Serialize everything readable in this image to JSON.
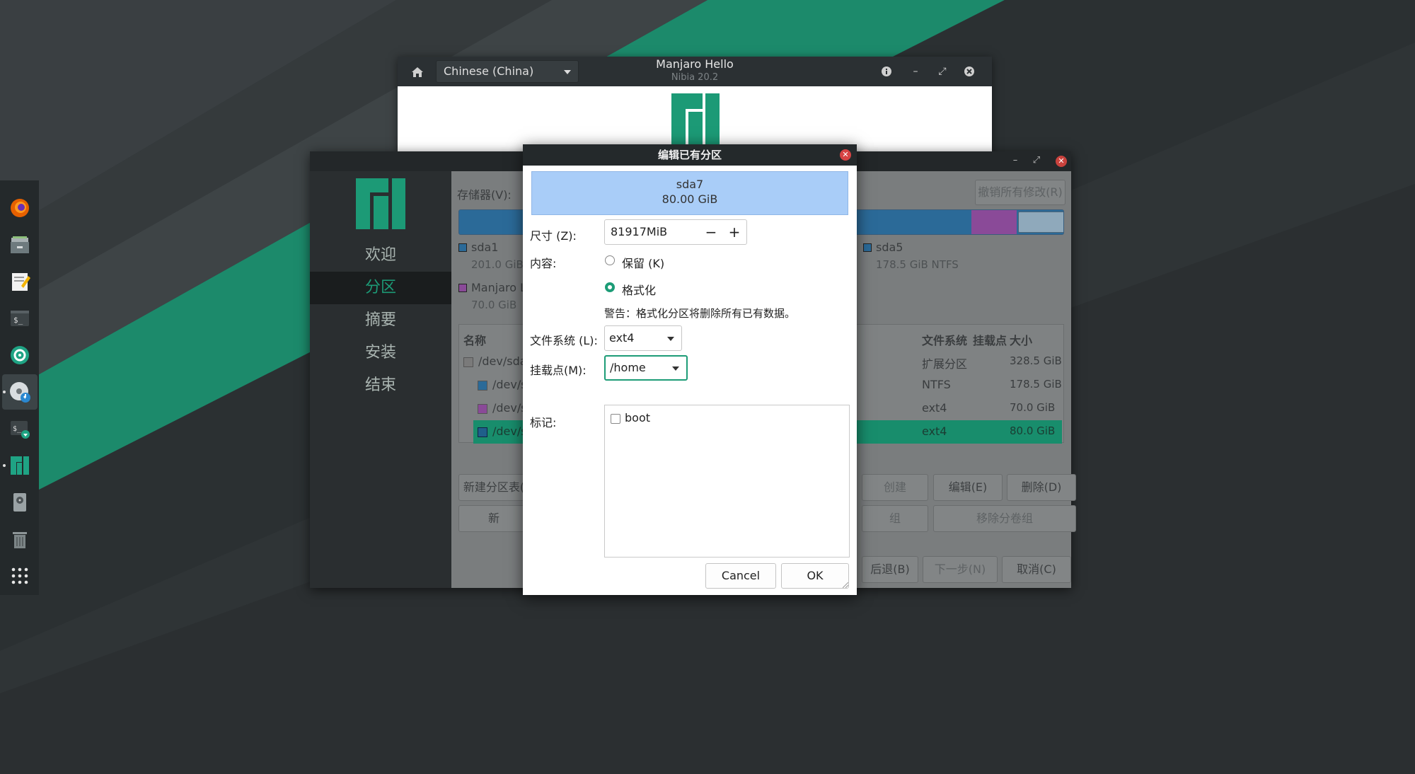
{
  "hello_window": {
    "language": "Chinese (China)",
    "title": "Manjaro Hello",
    "subtitle": "Nibia 20.2"
  },
  "installer": {
    "nav": [
      "欢迎",
      "分区",
      "摘要",
      "安装",
      "结束"
    ],
    "active_nav_index": 1,
    "storage_label": "存储器(V):",
    "revert_button": "撤销所有修改(R)",
    "legend": [
      {
        "name": "sda1",
        "detail": "201.0 GiB",
        "color": "#2b6a98"
      },
      {
        "name": "Manjaro L",
        "detail": "70.0 GiB",
        "color": "#8a4a98"
      },
      {
        "name": "sda5",
        "detail": "178.5 GiB  NTFS",
        "color": "#2b6a98"
      }
    ],
    "table_headers": {
      "name": "名称",
      "fs": "文件系统",
      "mount": "挂载点",
      "size": "大小"
    },
    "rows": [
      {
        "name": "/dev/sda",
        "fs": "扩展分区",
        "size": "328.5 GiB",
        "color": "#7a7a7a"
      },
      {
        "name": "/dev/s",
        "fs": "NTFS",
        "size": "178.5 GiB",
        "color": "#2b6a98"
      },
      {
        "name": "/dev/s",
        "fs": "ext4",
        "size": "70.0 GiB",
        "color": "#8a4a98"
      },
      {
        "name": "/dev/s",
        "fs": "ext4",
        "size": "80.0 GiB",
        "color": "#1f5f8a"
      }
    ],
    "selected_row_index": 3,
    "buttons": {
      "new_table": "新建分区表(",
      "create": "创建",
      "edit": "编辑(E)",
      "delete": "删除(D)",
      "new_vg": "新",
      "resize_vg": "组",
      "remove_vg": "移除分卷组",
      "back": "后退(B)",
      "next": "下一步(N)",
      "cancel": "取消(C)"
    }
  },
  "dialog": {
    "title": "编辑已有分区",
    "partition_name": "sda7",
    "partition_size": "80.00 GiB",
    "size_label": "尺寸 (Z):",
    "size_value": "81917MiB",
    "content_label": "内容:",
    "keep_option": "保留 (K)",
    "format_option": "格式化",
    "format_selected": true,
    "warning": "警告：格式化分区将删除所有已有数据。",
    "filesystem_label": "文件系统 (L):",
    "filesystem_value": "ext4",
    "mount_label": "挂载点(M):",
    "mount_value": "/home",
    "flags_label": "标记:",
    "flags": [
      {
        "name": "boot",
        "checked": false
      }
    ],
    "cancel_button": "Cancel",
    "ok_button": "OK"
  },
  "dock_items": [
    "firefox-icon",
    "files-icon",
    "text-editor-icon",
    "terminal-icon",
    "timeshift-icon",
    "installer-disc-icon",
    "terminal-install-icon",
    "manjaro-hello-icon",
    "disk-utility-icon",
    "trash-icon",
    "app-grid-icon"
  ],
  "colors": {
    "accent": "#1c9a76",
    "desktop_dark": "#2e3234",
    "selection_blue": "#a9cdf8"
  }
}
